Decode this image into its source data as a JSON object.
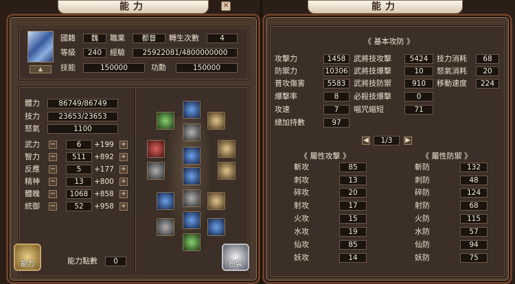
{
  "left": {
    "title": "能力",
    "profile": {
      "nation_label": "國籍",
      "nation": "魏",
      "job_label": "職業",
      "job": "都督",
      "rebirth_label": "轉生次數",
      "rebirth": "4",
      "level_label": "等級",
      "level": "240",
      "exp_label": "經驗",
      "exp": "25922081/4800000000",
      "skill_label": "技能",
      "skill": "150000",
      "merit_label": "功勳",
      "merit": "150000"
    },
    "vitals": [
      {
        "label": "體力",
        "value": "86749/86749"
      },
      {
        "label": "技力",
        "value": "23653/23653"
      },
      {
        "label": "怒氣",
        "value": "1100"
      }
    ],
    "stats": [
      {
        "label": "武力",
        "value": "6",
        "bonus": "+199"
      },
      {
        "label": "智力",
        "value": "511",
        "bonus": "+892"
      },
      {
        "label": "反應",
        "value": "5",
        "bonus": "+177"
      },
      {
        "label": "精神",
        "value": "13",
        "bonus": "+800"
      },
      {
        "label": "體魄",
        "value": "1068",
        "bonus": "+858"
      },
      {
        "label": "統御",
        "value": "52",
        "bonus": "+958"
      }
    ],
    "minus": "−",
    "plus": "+",
    "ability_points_label": "能力點數",
    "ability_points": "0",
    "ability_button": "能力",
    "costume_button": "扮裝"
  },
  "right": {
    "title": "能力",
    "basic_header": "《 基本攻防 》",
    "col1": [
      {
        "label": "攻擊力",
        "value": "1458"
      },
      {
        "label": "防禦力",
        "value": "10306"
      },
      {
        "label": "普攻傷害",
        "value": "5583"
      },
      {
        "label": "爆擊率",
        "value": "8"
      },
      {
        "label": "攻速",
        "value": "7"
      },
      {
        "label": "總加持數",
        "value": "97"
      }
    ],
    "col2": [
      {
        "label": "武將技攻擊",
        "value": "5424"
      },
      {
        "label": "武將技爆擊",
        "value": "10"
      },
      {
        "label": "武將技防禦",
        "value": "910"
      },
      {
        "label": "必殺技爆擊",
        "value": "0"
      },
      {
        "label": "唱咒縮短",
        "value": "71"
      }
    ],
    "col3": [
      {
        "label": "技力消耗",
        "value": "68"
      },
      {
        "label": "怒氣消耗",
        "value": "20"
      },
      {
        "label": "移動速度",
        "value": "224"
      }
    ],
    "page": "1/3",
    "attr_attack_header": "《 屬性攻擊 》",
    "attr_defense_header": "《 屬性防禦 》",
    "attr_attack": [
      {
        "label": "斬攻",
        "value": "85"
      },
      {
        "label": "刺攻",
        "value": "13"
      },
      {
        "label": "碎攻",
        "value": "20"
      },
      {
        "label": "射攻",
        "value": "17"
      },
      {
        "label": "火攻",
        "value": "15"
      },
      {
        "label": "水攻",
        "value": "19"
      },
      {
        "label": "仙攻",
        "value": "85"
      },
      {
        "label": "妖攻",
        "value": "14"
      }
    ],
    "attr_defense": [
      {
        "label": "斬防",
        "value": "132"
      },
      {
        "label": "刺防",
        "value": "48"
      },
      {
        "label": "碎防",
        "value": "124"
      },
      {
        "label": "射防",
        "value": "68"
      },
      {
        "label": "火防",
        "value": "115"
      },
      {
        "label": "水防",
        "value": "57"
      },
      {
        "label": "仙防",
        "value": "94"
      },
      {
        "label": "妖防",
        "value": "75"
      }
    ]
  }
}
